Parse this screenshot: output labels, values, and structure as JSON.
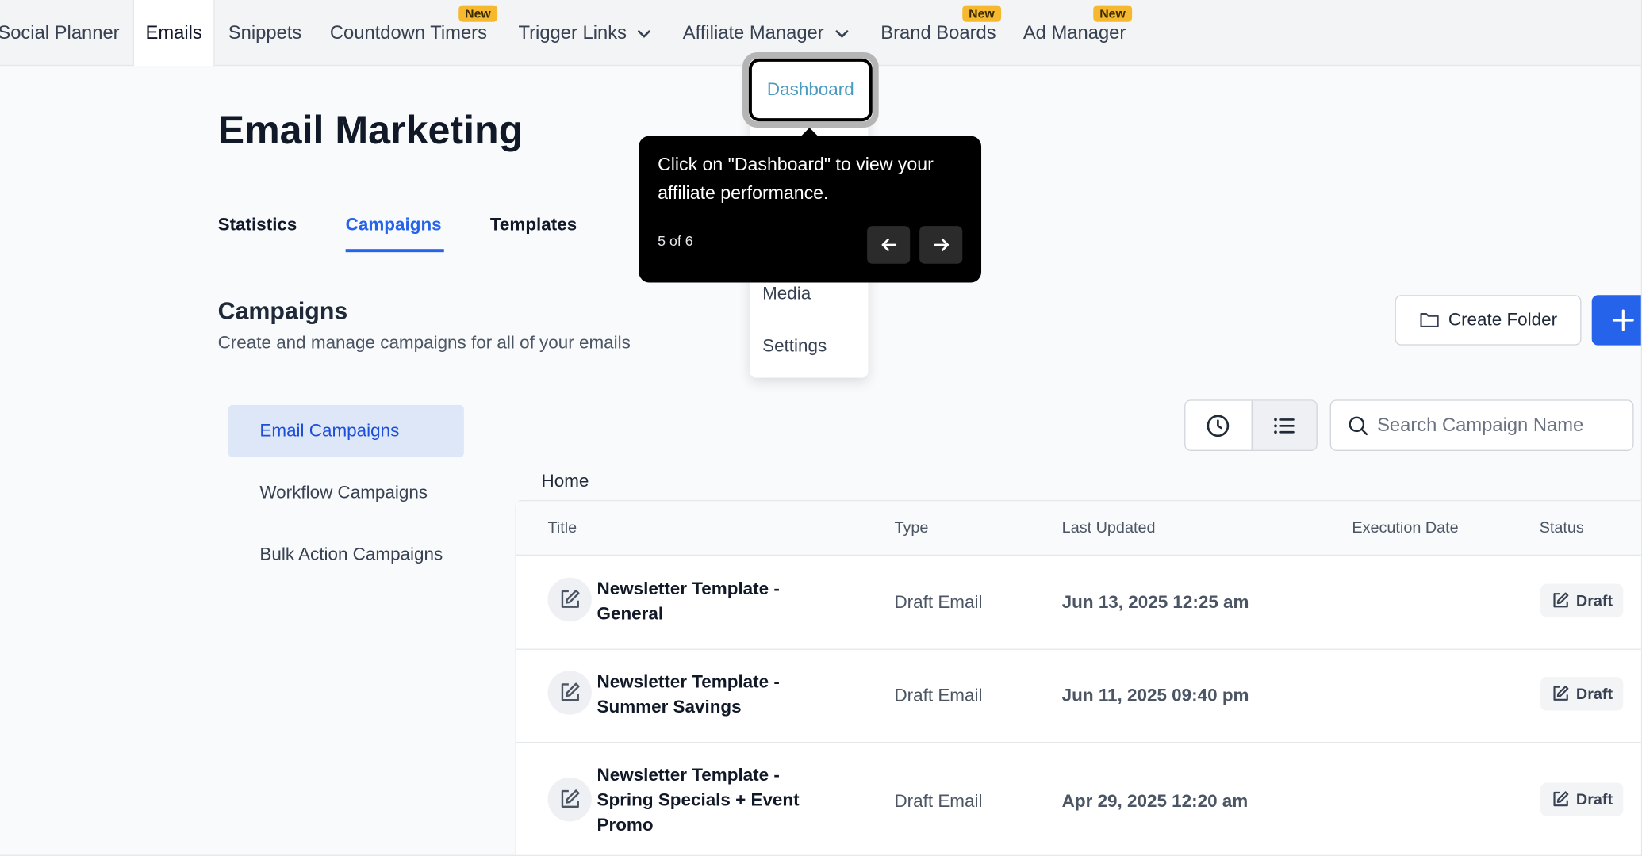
{
  "topnav": {
    "items": [
      {
        "label": "Social Planner",
        "active": false
      },
      {
        "label": "Emails",
        "active": true
      },
      {
        "label": "Snippets",
        "active": false
      },
      {
        "label": "Countdown Timers",
        "badge": "New"
      },
      {
        "label": "Trigger Links",
        "dropdown": true
      },
      {
        "label": "Affiliate Manager",
        "dropdown": true
      },
      {
        "label": "Brand Boards",
        "badge": "New"
      },
      {
        "label": "Ad Manager",
        "badge": "New"
      }
    ]
  },
  "page": {
    "title": "Email Marketing",
    "tabs": [
      {
        "label": "Statistics"
      },
      {
        "label": "Campaigns",
        "active": true
      },
      {
        "label": "Templates"
      }
    ],
    "section_title": "Campaigns",
    "section_subtitle": "Create and manage campaigns for all of your emails",
    "create_folder_label": "Create Folder"
  },
  "subnav": {
    "items": [
      {
        "label": "Email Campaigns",
        "active": true
      },
      {
        "label": "Workflow Campaigns"
      },
      {
        "label": "Bulk Action Campaigns"
      }
    ]
  },
  "search": {
    "placeholder": "Search Campaign Name",
    "value": ""
  },
  "breadcrumb": "Home",
  "table": {
    "columns": [
      "Title",
      "Type",
      "Last Updated",
      "Execution Date",
      "Status"
    ],
    "rows": [
      {
        "title": "Newsletter Template - General",
        "type": "Draft Email",
        "last_updated": "Jun 13, 2025 12:25 am",
        "execution_date": "",
        "status": "Draft"
      },
      {
        "title": "Newsletter Template - Summer Savings",
        "type": "Draft Email",
        "last_updated": "Jun 11, 2025 09:40 pm",
        "execution_date": "",
        "status": "Draft"
      },
      {
        "title": "Newsletter Template - Spring Specials + Event Promo",
        "type": "Draft Email",
        "last_updated": "Apr 29, 2025 12:20 am",
        "execution_date": "",
        "status": "Draft"
      }
    ]
  },
  "dropdown": {
    "items": [
      "Dashboard",
      "Media",
      "Settings"
    ]
  },
  "tooltip": {
    "text": "Click on \"Dashboard\" to view your affiliate performance.",
    "step": "5 of 6"
  },
  "colors": {
    "accent": "#2563eb",
    "badge": "#f5b82e",
    "dropdown_highlight": "#4a9bc0"
  }
}
